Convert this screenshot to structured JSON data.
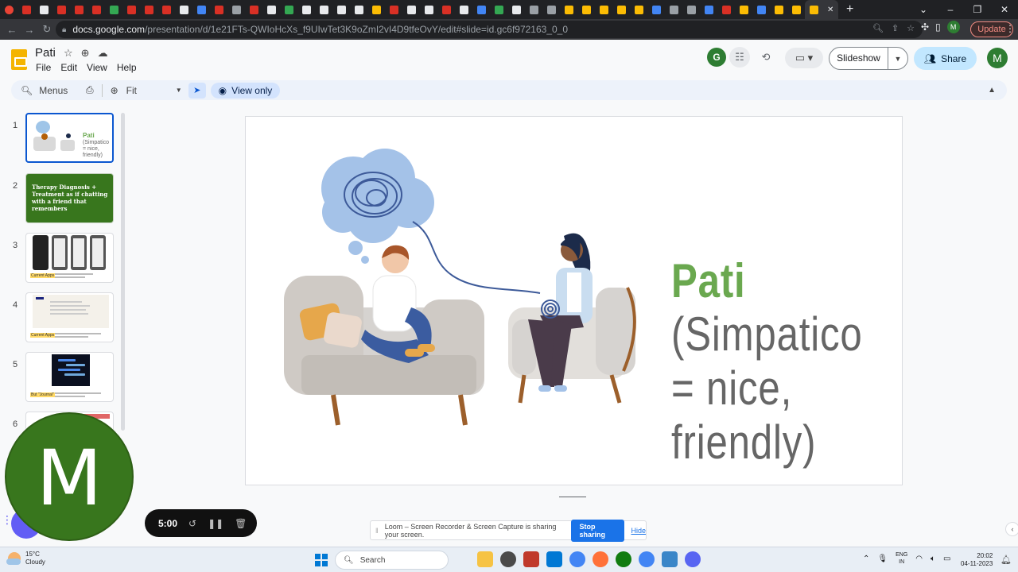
{
  "browser": {
    "url_host": "docs.google.com",
    "url_path": "/presentation/d/1e21FTs-QWIoHcXs_f9UIwTet3K9oZmI2vI4D9tfeOvY/edit#slide=id.gc6f972163_0_0",
    "update_label": "Update",
    "profile_initial": "M"
  },
  "doc": {
    "title": "Pati",
    "menus": [
      "File",
      "Edit",
      "View",
      "Help"
    ],
    "collaborator_initial": "G",
    "slideshow_label": "Slideshow",
    "share_label": "Share",
    "user_initial": "M"
  },
  "toolbar": {
    "menus_label": "Menus",
    "zoom_label": "Fit",
    "view_only_label": "View only"
  },
  "filmstrip": {
    "numbers": [
      "1",
      "2",
      "3",
      "4",
      "5",
      "6"
    ],
    "slide1": {
      "title": "Pati",
      "subtitle": "(Simpatico = nice, friendly)"
    },
    "slide2": {
      "title": "Therapy Diagnosis + Treatment as if chatting with a friend that remembers"
    },
    "slide3": {
      "tag": "Current Apps"
    },
    "slide4": {
      "tag": "Current Apps"
    },
    "slide5": {
      "tag": "But \"Journal\""
    }
  },
  "slide": {
    "title": "Pati",
    "subtitle": "(Simpatico = nice, friendly)",
    "title_color": "#6aa84f",
    "subtitle_color": "#666666"
  },
  "loom": {
    "avatar_initial": "M",
    "timer": "5:00",
    "banner_text": "Loom – Screen Recorder & Screen Capture is sharing your screen.",
    "stop_label": "Stop sharing",
    "hide_label": "Hide"
  },
  "taskbar": {
    "temperature": "15°C",
    "condition": "Cloudy",
    "search_label": "Search",
    "lang_top": "ENG",
    "lang_bottom": "IN",
    "time": "20:02",
    "date": "04-11-2023"
  },
  "icons": [
    "star-icon",
    "move-icon",
    "cloud-icon",
    "history-icon",
    "camera-icon",
    "search-icon",
    "print-icon",
    "zoom-icon",
    "pointer-icon",
    "eye-icon",
    "people-icon",
    "windows-start-icon"
  ]
}
